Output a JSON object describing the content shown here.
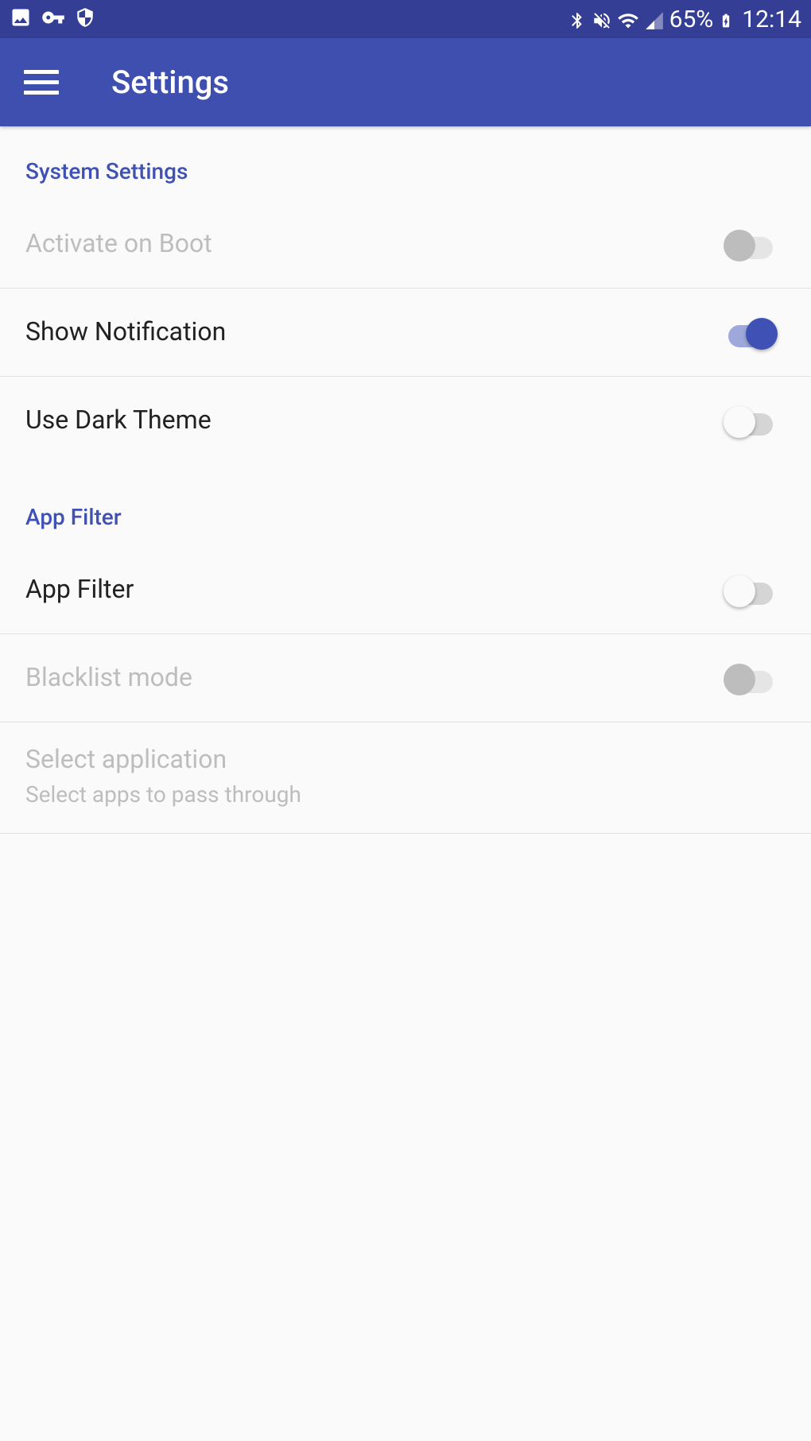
{
  "status_bar": {
    "battery_text": "65%",
    "time": "12:14"
  },
  "app_bar": {
    "title": "Settings"
  },
  "sections": {
    "system": {
      "header": "System Settings",
      "activate_on_boot": "Activate on Boot",
      "show_notification": "Show Notification",
      "use_dark_theme": "Use Dark Theme"
    },
    "app_filter": {
      "header": "App Filter",
      "app_filter": "App Filter",
      "blacklist_mode": "Blacklist mode",
      "select_application": "Select application",
      "select_application_sub": "Select apps to pass through"
    }
  }
}
